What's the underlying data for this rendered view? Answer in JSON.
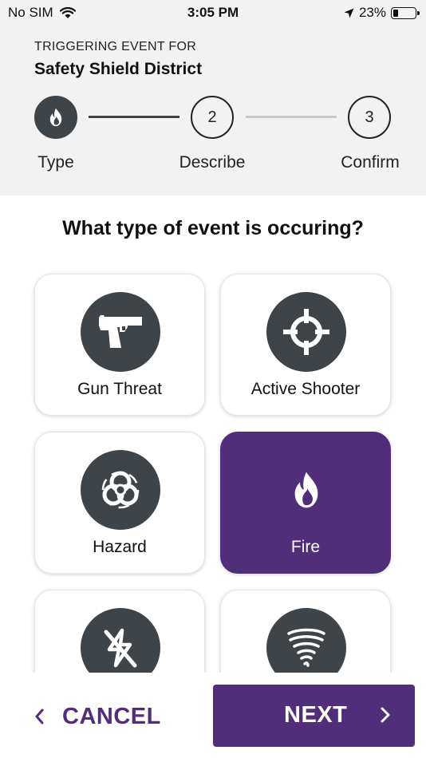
{
  "status_bar": {
    "carrier": "No SIM",
    "time": "3:05 PM",
    "battery": "23%"
  },
  "header": {
    "kicker": "TRIGGERING EVENT FOR",
    "district": "Safety Shield District"
  },
  "steps": [
    {
      "number": "",
      "label": "Type",
      "state": "active",
      "icon": "fire-icon"
    },
    {
      "number": "2",
      "label": "Describe",
      "state": "upcoming"
    },
    {
      "number": "3",
      "label": "Confirm",
      "state": "upcoming"
    }
  ],
  "question": "What type of event is occuring?",
  "event_types": [
    {
      "label": "Gun Threat",
      "icon": "gun-icon",
      "selected": false
    },
    {
      "label": "Active Shooter",
      "icon": "crosshair-icon",
      "selected": false
    },
    {
      "label": "Hazard",
      "icon": "biohazard-icon",
      "selected": false
    },
    {
      "label": "Fire",
      "icon": "fire-icon",
      "selected": true
    },
    {
      "label": "",
      "icon": "power-outage-icon",
      "selected": false
    },
    {
      "label": "",
      "icon": "tornado-icon",
      "selected": false
    }
  ],
  "actions": {
    "cancel": "CANCEL",
    "next": "NEXT"
  },
  "colors": {
    "brand_purple": "#512e7a",
    "icon_disc": "#3e4447",
    "header_bg": "#f2f2f2"
  }
}
